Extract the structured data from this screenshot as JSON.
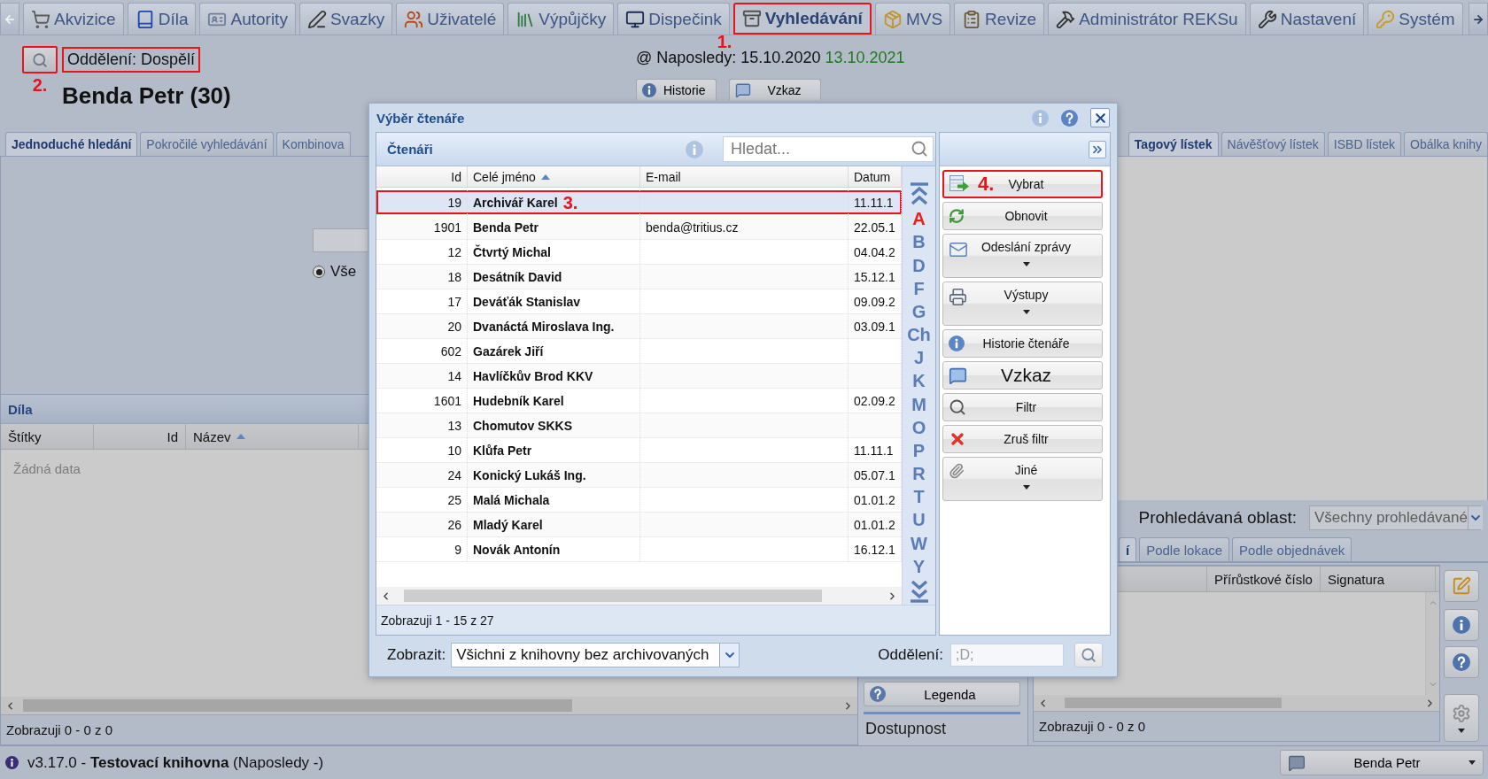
{
  "main_tabs": [
    {
      "label": "Akvizice",
      "selected": false
    },
    {
      "label": "Díla",
      "selected": false
    },
    {
      "label": "Autority",
      "selected": false
    },
    {
      "label": "Svazky",
      "selected": false
    },
    {
      "label": "Uživatelé",
      "selected": false
    },
    {
      "label": "Výpůjčky",
      "selected": false
    },
    {
      "label": "Dispečink",
      "selected": false
    },
    {
      "label": "Vyhledávání",
      "selected": true,
      "callout": "1."
    },
    {
      "label": "MVS",
      "selected": false
    },
    {
      "label": "Revize",
      "selected": false
    },
    {
      "label": "Administrátor REKSu",
      "selected": false
    },
    {
      "label": "Nastavení",
      "selected": false
    },
    {
      "label": "Systém",
      "selected": false
    }
  ],
  "header": {
    "department": "Oddělení: Dospělí",
    "callout": "2.",
    "reader": "Benda Petr (30)",
    "last_visit": "@ Naposledy: 15.10.2020",
    "valid_until": "13.10.2021",
    "buttons": [
      "Historie",
      "Vzkaz"
    ]
  },
  "search_panel": {
    "tabs": [
      {
        "label": "Jednoduché hledání",
        "selected": true
      },
      {
        "label": "Pokročilé vyhledávání",
        "selected": false
      },
      {
        "label": "Kombinova",
        "selected": false
      }
    ],
    "options": [
      {
        "label": "Vše",
        "checked": true
      }
    ]
  },
  "works_panel": {
    "title": "Díla",
    "columns": [
      {
        "label": "Štítky",
        "sorted": false
      },
      {
        "label": "Id",
        "sorted": false
      },
      {
        "label": "Název",
        "sorted": true
      }
    ],
    "empty_message": "Žádná data",
    "footer": "Zobrazuji 0 - 0 z 0"
  },
  "preview_tabs": [
    {
      "label": "Tagový lístek",
      "selected": true
    },
    {
      "label": "Návěšťový lístek",
      "selected": false
    },
    {
      "label": "ISBD lístek",
      "selected": false
    },
    {
      "label": "Obálka knihy",
      "selected": false
    }
  ],
  "availability": {
    "legend_button": "Legenda",
    "title": "Dostupnost"
  },
  "holdings_panel": {
    "area_label": "Prohledávaná oblast:",
    "area_value": "Všechny prohledávané",
    "tabs": [
      {
        "label": "í",
        "selected": true
      },
      {
        "label": "Podle lokace",
        "selected": false
      },
      {
        "label": "Podle objednávek",
        "selected": false
      }
    ],
    "columns": [
      "Přírůstkové číslo",
      "Signatura"
    ],
    "footer": "Zobrazuji 0 - 0 z 0"
  },
  "reader_dialog": {
    "title": "Výběr čtenáře",
    "panel_title": "Čtenáři",
    "search": {
      "placeholder": "Hledat..."
    },
    "columns": [
      {
        "label": "Id",
        "sorted": false
      },
      {
        "label": "Celé jméno",
        "sorted": true
      },
      {
        "label": "E-mail",
        "sorted": false
      },
      {
        "label": "Datum",
        "sorted": false
      }
    ],
    "rows": [
      {
        "id": "19",
        "name": "Archivář Karel",
        "date": "11.11.1",
        "selected": true,
        "callout": "3."
      },
      {
        "id": "1901",
        "name": "Benda Petr",
        "email": "benda@tritius.cz",
        "date": "22.05.1",
        "selected": false
      },
      {
        "id": "12",
        "name": "Čtvrtý Michal",
        "date": "04.04.2",
        "selected": false
      },
      {
        "id": "18",
        "name": "Desátník David",
        "date": "15.12.1",
        "selected": false
      },
      {
        "id": "17",
        "name": "Deváťák Stanislav",
        "date": "09.09.2",
        "selected": false
      },
      {
        "id": "20",
        "name": "Dvanáctá Miroslava Ing.",
        "date": "03.09.1",
        "selected": false
      },
      {
        "id": "602",
        "name": "Gazárek Jiří",
        "selected": false
      },
      {
        "id": "14",
        "name": "Havlíčkův Brod KKV",
        "selected": false
      },
      {
        "id": "1601",
        "name": "Hudebník Karel",
        "date": "02.09.2",
        "selected": false
      },
      {
        "id": "13",
        "name": "Chomutov SKKS",
        "selected": false
      },
      {
        "id": "10",
        "name": "Klůfa Petr",
        "date": "11.11.1",
        "selected": false
      },
      {
        "id": "24",
        "name": "Konický Lukáš Ing.",
        "date": "05.07.1",
        "selected": false
      },
      {
        "id": "25",
        "name": "Malá Michala",
        "date": "01.01.2",
        "selected": false
      },
      {
        "id": "26",
        "name": "Mladý Karel",
        "date": "01.01.2",
        "selected": false
      },
      {
        "id": "9",
        "name": "Novák Antonín",
        "date": "16.12.1",
        "selected": false
      }
    ],
    "letters": [
      {
        "letter": "A",
        "selected": true
      },
      {
        "letter": "B",
        "selected": false
      },
      {
        "letter": "D",
        "selected": false
      },
      {
        "letter": "F",
        "selected": false
      },
      {
        "letter": "G",
        "selected": false
      },
      {
        "letter": "Ch",
        "selected": false
      },
      {
        "letter": "J",
        "selected": false
      },
      {
        "letter": "K",
        "selected": false
      },
      {
        "letter": "M",
        "selected": false
      },
      {
        "letter": "O",
        "selected": false
      },
      {
        "letter": "P",
        "selected": false
      },
      {
        "letter": "R",
        "selected": false
      },
      {
        "letter": "T",
        "selected": false
      },
      {
        "letter": "U",
        "selected": false
      },
      {
        "letter": "W",
        "selected": false
      },
      {
        "letter": "Y",
        "selected": false
      }
    ],
    "footer": "Zobrazuji 1 - 15 z 27",
    "actions": [
      {
        "label": "Vybrat",
        "kind": "plain",
        "callout": "4."
      },
      {
        "label": "Obnovit",
        "kind": "plain"
      },
      {
        "label": "Odeslání zprávy",
        "kind": "menu"
      },
      {
        "label": "Výstupy",
        "kind": "menu"
      },
      {
        "label": "Historie čtenáře",
        "kind": "plain"
      },
      {
        "label": "Vzkaz",
        "kind": "big"
      },
      {
        "label": "Filtr",
        "kind": "plain"
      },
      {
        "label": "Zruš filtr",
        "kind": "plain"
      },
      {
        "label": "Jiné",
        "kind": "menu"
      }
    ],
    "filter_label": "Zobrazit:",
    "filter_value": "Všichni z knihovny bez archivovaných",
    "department_label": "Oddělení:",
    "department_field": {
      "value": ";D;",
      "disabled": true
    }
  },
  "status_bar": {
    "version": "v3.17.0 - **Testovací knihovna** (Naposledy -)",
    "user": "Benda Petr"
  }
}
